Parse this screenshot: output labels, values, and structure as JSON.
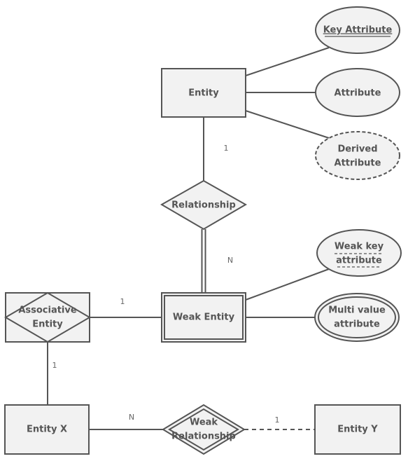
{
  "nodes": {
    "entity": "Entity",
    "key_attribute": "Key Attribute",
    "attribute": "Attribute",
    "derived_attribute": [
      "Derived",
      "Attribute"
    ],
    "relationship": "Relationship",
    "weak_key_attribute": [
      "Weak key",
      "attribute"
    ],
    "weak_entity": "Weak Entity",
    "multi_value_attribute": [
      "Multi value",
      "attribute"
    ],
    "associative_entity": [
      "Associative",
      "Entity"
    ],
    "entity_x": "Entity X",
    "weak_relationship": [
      "Weak",
      "Relationship"
    ],
    "entity_y": "Entity Y"
  },
  "cardinalities": {
    "entity_relationship": "1",
    "relationship_weak_entity": "N",
    "associative_weak_entity": "1",
    "associative_entity_x": "1",
    "entity_x_weak_relationship": "N",
    "weak_relationship_entity_y": "1"
  },
  "colors": {
    "fill": "#f2f2f2",
    "stroke": "#555555",
    "text": "#555555"
  }
}
